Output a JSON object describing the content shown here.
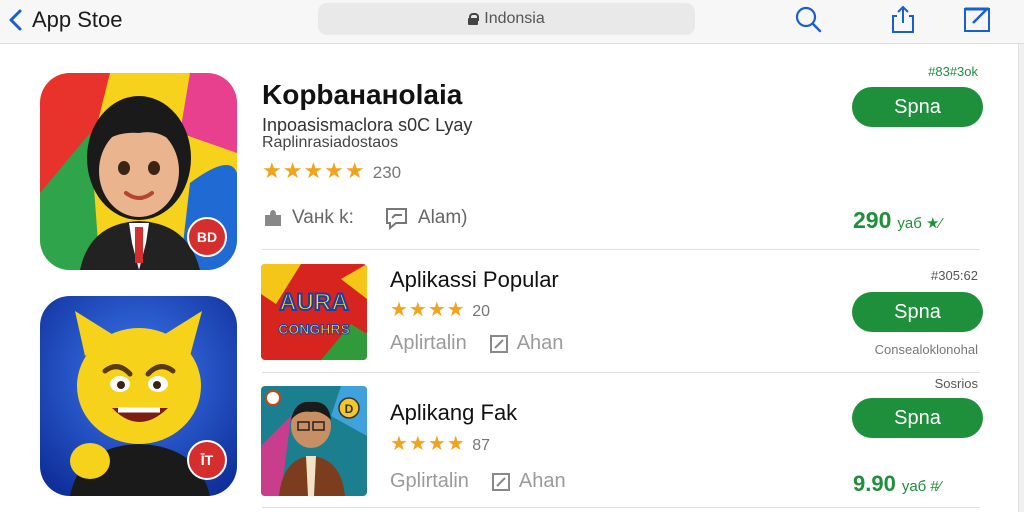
{
  "topbar": {
    "back_label": "App Stoe",
    "url": "Indonsia"
  },
  "icons": {
    "back": "chevron-left-icon",
    "lock": "lock-icon",
    "search": "search-icon",
    "share": "share-icon",
    "compose": "compose-icon"
  },
  "colors": {
    "accent_green": "#1e8f3a",
    "star": "#f2a31c",
    "back_blue": "#1a5fd0"
  },
  "featured": {
    "title": "Kopbaнaнolaia",
    "subtitle_1": "Inpoasismaclora s0C Lyay",
    "subtitle_2": "Raplinrasiadostaos",
    "rating_stars": "★★★★★",
    "rating_count": "230",
    "meta_1": "Vaнk k:",
    "meta_2": "Alam)",
    "top_label": "#83#3ok",
    "button_label": "Spna",
    "price": "290",
    "price_unit": "yaб ★⁄"
  },
  "apps": [
    {
      "title": "Aplikassi Popular",
      "rating_stars": "★★★★",
      "rating_count": "20",
      "meta_1": "Aplirtalin",
      "meta_2": "Ahan",
      "top_label": "#305:62",
      "button_label": "Spna",
      "bottom_label": "Consealoklonohal",
      "icon_text": "AURA",
      "icon_text_2": "CONGHRS"
    },
    {
      "title": "Aplikang Fak",
      "rating_stars": "★★★★",
      "rating_count": "87",
      "meta_1": "Gplirtalin",
      "meta_2": "Ahan",
      "top_label": "Sosrios",
      "button_label": "Spna",
      "price": "9.90",
      "price_unit": "yaб #⁄"
    }
  ],
  "badges": {
    "featured_badge": "BD",
    "second_badge": "ĪT",
    "coin_label": "D"
  }
}
